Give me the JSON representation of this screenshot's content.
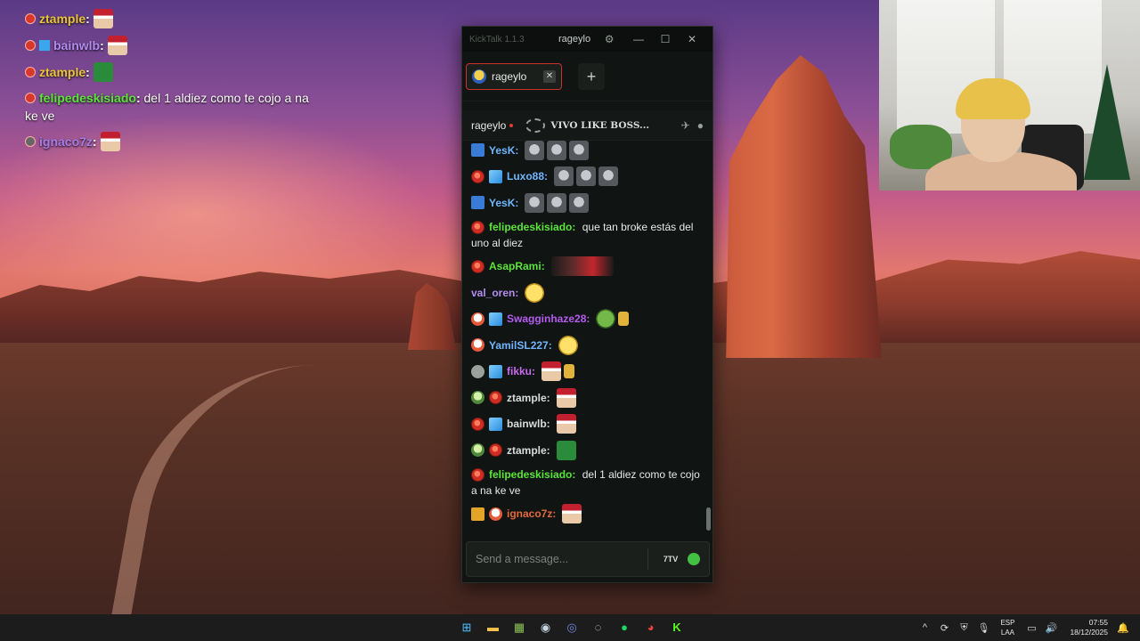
{
  "overlay": {
    "messages": [
      {
        "user": "ztample",
        "color": "#e9c53b",
        "text": ""
      },
      {
        "user": "bainwlb",
        "color": "#b48cf0",
        "text": ""
      },
      {
        "user": "ztample",
        "color": "#e9c53b",
        "text": ""
      },
      {
        "user": "felipedeskisiado",
        "color": "#5be43a",
        "text": "del 1 aldiez como te cojo a na ke ve"
      },
      {
        "user": "ignaco7z",
        "color": "#a67ce8",
        "text": ""
      }
    ]
  },
  "window": {
    "app_title": "KickTalk 1.1.3",
    "user": "rageylo",
    "settings_icon": "gear-icon",
    "minimize": "—",
    "maximize": "☐",
    "close": "✕"
  },
  "tabs": [
    {
      "label": "rageylo",
      "close": "✕"
    }
  ],
  "add_tab": "+",
  "channel": {
    "name": "rageylo",
    "status": "VIVO LIKE BOSS..."
  },
  "chat": {
    "messages": [
      {
        "badges": [
          "prime"
        ],
        "user": "YesK:",
        "color": "#6fb6ff",
        "text": "",
        "emotes": [
          "grey",
          "grey",
          "grey"
        ]
      },
      {
        "badges": [
          "red",
          "cube"
        ],
        "user": "Luxo88:",
        "color": "#6fb6ff",
        "text": "",
        "emotes": [
          "grey",
          "grey",
          "grey"
        ]
      },
      {
        "badges": [
          "prime"
        ],
        "user": "YesK:",
        "color": "#6fb6ff",
        "text": "",
        "emotes": [
          "grey",
          "grey",
          "grey"
        ]
      },
      {
        "badges": [
          "red"
        ],
        "user": "felipedeskisiado:",
        "color": "#5be43a",
        "text": "que tan broke estás del uno al diez",
        "emotes": []
      },
      {
        "badges": [
          "red"
        ],
        "user": "AsapRami:",
        "color": "#5be43a",
        "text": "",
        "emotes": [
          "wide"
        ]
      },
      {
        "badges": [],
        "user": "val_oren:",
        "color": "#b48cf0",
        "text": "",
        "emotes": [
          "smile"
        ]
      },
      {
        "badges": [
          "skull",
          "cube"
        ],
        "user": "Swagginhaze28:",
        "color": "#b45cf0",
        "text": "",
        "emotes": [
          "frog",
          "hand"
        ]
      },
      {
        "badges": [
          "skull"
        ],
        "user": "YamilSL227:",
        "color": "#6fb6ff",
        "text": "",
        "emotes": [
          "smile"
        ]
      },
      {
        "badges": [
          "grey",
          "cube"
        ],
        "user": "fikku:",
        "color": "#c76bf0",
        "text": "",
        "emotes": [
          "santa",
          "hand"
        ]
      },
      {
        "badges": [
          "alien",
          "red"
        ],
        "user": "ztample:",
        "color": "#d9dcda",
        "text": "",
        "emotes": [
          "santa"
        ]
      },
      {
        "badges": [
          "red",
          "cube"
        ],
        "user": "bainwlb:",
        "color": "#d9dcda",
        "text": "",
        "emotes": [
          "santa"
        ]
      },
      {
        "badges": [
          "alien",
          "red"
        ],
        "user": "ztample:",
        "color": "#d9dcda",
        "text": "",
        "emotes": [
          "green"
        ]
      },
      {
        "badges": [
          "red"
        ],
        "user": "felipedeskisiado:",
        "color": "#5be43a",
        "text": "del 1 aldiez como te cojo a na ke ve",
        "emotes": []
      },
      {
        "badges": [
          "7tv",
          "skull"
        ],
        "user": "ignaco7z:",
        "color": "#e26a3a",
        "text": "",
        "emotes": [
          "santa"
        ]
      }
    ]
  },
  "input": {
    "placeholder": "Send a message...",
    "emote_btn": "7TV"
  },
  "taskbar": {
    "language": "ESP",
    "layout": "LAA",
    "time": "07:55",
    "date": "18/12/2025",
    "apps": [
      "windows-start-icon",
      "file-explorer-icon",
      "game-app-icon",
      "steam-icon",
      "discord-icon",
      "obs-icon",
      "spotify-icon",
      "chrome-icon",
      "kick-icon"
    ]
  }
}
